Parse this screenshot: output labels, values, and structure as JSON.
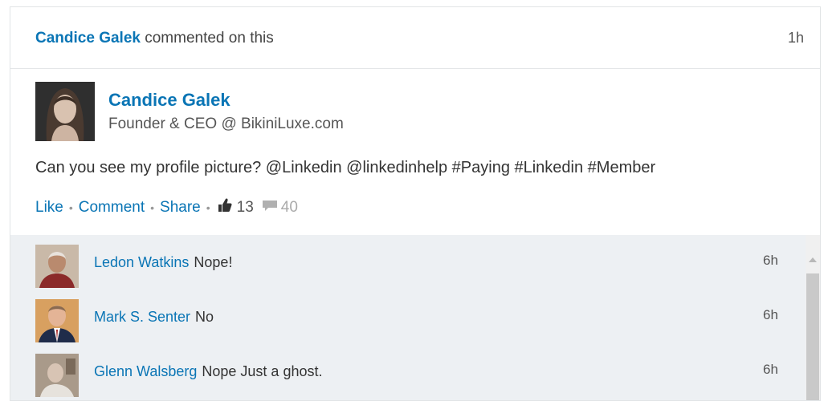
{
  "activity": {
    "actor": "Candice Galek",
    "action": "commented on this",
    "time": "1h"
  },
  "post": {
    "author": "Candice Galek",
    "headline": "Founder & CEO @ BikiniLuxe.com",
    "text": "Can you see my profile picture? @Linkedin @linkedinhelp #Paying #Linkedin #Member",
    "actions": {
      "like": "Like",
      "comment": "Comment",
      "share": "Share",
      "separator": "•",
      "likes_count": "13",
      "comments_count": "40"
    }
  },
  "comments": [
    {
      "name": "Ledon Watkins",
      "text": "Nope!",
      "time": "6h"
    },
    {
      "name": "Mark S. Senter",
      "text": "No",
      "time": "6h"
    },
    {
      "name": "Glenn Walsberg",
      "text": "Nope Just a ghost.",
      "time": "6h"
    }
  ],
  "colors": {
    "link": "#0a75b5",
    "comments_background": "#edf0f3"
  },
  "icons": [
    "thumbs-up-icon",
    "speech-bubble-icon",
    "scroll-up-arrow-icon"
  ]
}
